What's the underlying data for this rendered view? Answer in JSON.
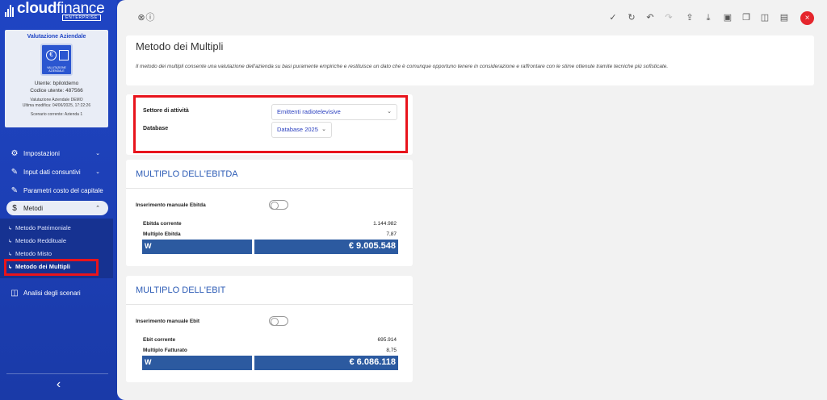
{
  "brand": {
    "name_bold": "cloud",
    "name_light": "finance",
    "tag": "ENTERPRISE"
  },
  "card": {
    "title": "Valutazione Aziendale",
    "icon_caption": "VALUTAZIONE AZIENDALE",
    "user": "Utente: bpilotdemo",
    "code": "Codice utente: 487566",
    "meta1": "Valutazione Aziendale DEMO",
    "meta2": "Ultima modifica: 04/06/2025, 17:22:26",
    "scenario": "Scenario corrente: Azienda 1"
  },
  "nav": {
    "impostazioni": "Impostazioni",
    "input": "Input dati consuntivi",
    "parametri": "Parametri costo del capitale",
    "metodi": "Metodi",
    "sub": [
      "Metodo Patrimoniale",
      "Metodo Reddituale",
      "Metodo Misto",
      "Metodo dei Multipli"
    ],
    "analisi": "Analisi degli scenari",
    "collapse": "‹"
  },
  "header": {
    "title": "Metodo dei Multipli",
    "description": "Il metodo dei multipli consente una valutazione dell'azienda su basi puramente empiriche e restituisce un dato che è comunque opportuno tenere in considerazione e raffrontare con le stime ottenute tramite tecniche più sofisticate."
  },
  "settings": {
    "sector_label": "Settore di attività",
    "sector_value": "Emittenti radiotelevisive",
    "database_label": "Database",
    "database_value": "Database 2025"
  },
  "ebitda": {
    "title": "MULTIPLO DELL'EBITDA",
    "manual_label": "Inserimento manuale Ebitda",
    "manual_on": false,
    "rows": [
      {
        "label": "Ebitda corrente",
        "value": "1.144.982"
      },
      {
        "label": "Multiplo Ebitda",
        "value": "7,87"
      }
    ],
    "w_label": "W",
    "w_value": "€ 9.005.548"
  },
  "ebit": {
    "title": "MULTIPLO DELL'EBIT",
    "manual_label": "Inserimento manuale Ebit",
    "manual_on": false,
    "rows": [
      {
        "label": "Ebit corrente",
        "value": "695.914"
      },
      {
        "label": "Multiplo Fatturato",
        "value": "8,75"
      }
    ],
    "w_label": "W",
    "w_value": "€ 6.086.118"
  },
  "toolbar": {
    "left": [
      "grid-icon",
      "help-icon"
    ],
    "right": [
      "check-icon",
      "refresh-icon",
      "undo-icon",
      "redo-icon",
      "upload-icon",
      "download-icon",
      "save-icon",
      "copy-icon",
      "columns-icon",
      "notes-icon"
    ],
    "close": "×"
  },
  "colors": {
    "accent": "#1f45c4",
    "highlight": "#e8141c",
    "result_bar": "#2c5aa0"
  }
}
